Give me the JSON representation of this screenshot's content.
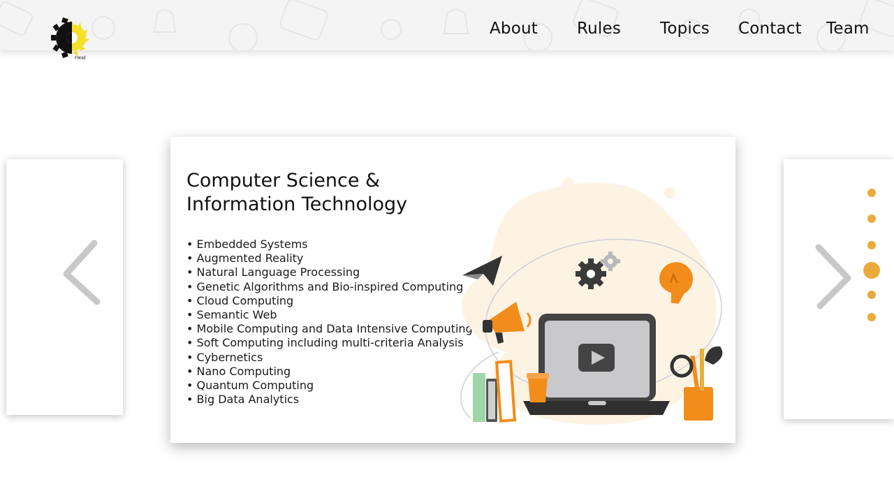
{
  "header": {
    "nav": [
      {
        "label": "About"
      },
      {
        "label": "Rules"
      },
      {
        "label": "Topics"
      },
      {
        "label": "Contact"
      },
      {
        "label": "Team"
      }
    ],
    "logo_icon": "sun-gear-logo-icon",
    "logo_caption": "FM4E"
  },
  "slide": {
    "title_line1": "Computer Science &",
    "title_line2": "Information Technology",
    "topics": [
      "Embedded Systems",
      "Augmented Reality",
      "Natural Language Processing",
      "Genetic Algorithms and Bio-inspired Computing",
      "Cloud Computing",
      "Semantic Web",
      "Mobile Computing and Data Intensive Computing",
      "Soft Computing including multi-criteria Analysis",
      "Cybernetics",
      "Nano Computing",
      "Quantum Computing",
      "Big Data Analytics"
    ],
    "illustration_icon": "laptop-study-illustration"
  },
  "carousel": {
    "prev_icon": "chevron-left-icon",
    "next_icon": "chevron-right-icon",
    "dot_count": 6,
    "active_dot": 4
  },
  "colors": {
    "accent": "#e9ab3b",
    "orange": "#f28c1b",
    "arrow": "#c8c8c8",
    "blob": "#fcf3e3"
  }
}
